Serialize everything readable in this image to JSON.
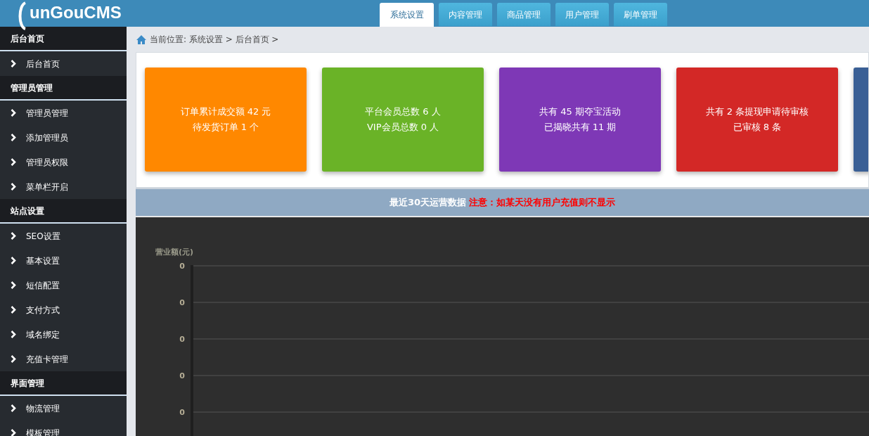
{
  "header": {
    "logo": "unGouCMS",
    "tabs": [
      {
        "label": "系统设置",
        "selected": true
      },
      {
        "label": "内容管理",
        "selected": false
      },
      {
        "label": "商品管理",
        "selected": false
      },
      {
        "label": "用户管理",
        "selected": false
      },
      {
        "label": "刷单管理",
        "selected": false
      }
    ]
  },
  "sidebar": {
    "sections": [
      {
        "title": "后台首页",
        "items": [
          "后台首页"
        ]
      },
      {
        "title": "管理员管理",
        "items": [
          "管理员管理",
          "添加管理员",
          "管理员权限",
          "菜单栏开启"
        ]
      },
      {
        "title": "站点设置",
        "items": [
          "SEO设置",
          "基本设置",
          "短信配置",
          "支付方式",
          "域名绑定",
          "充值卡管理"
        ]
      },
      {
        "title": "界面管理",
        "items": [
          "物流管理",
          "模板管理"
        ]
      }
    ]
  },
  "breadcrumb": "当前位置: 系统设置 > 后台首页 >",
  "stat_cards": [
    {
      "color": "#ff8800",
      "lines": [
        "订单累计成交额 42 元",
        "待发货订单 1 个"
      ]
    },
    {
      "color": "#6ab327",
      "lines": [
        "平台会员总数 6 人",
        "VIP会员总数 0 人"
      ]
    },
    {
      "color": "#7e38b6",
      "lines": [
        "共有 45 期夺宝活动",
        "已揭晓共有 11 期"
      ]
    },
    {
      "color": "#d32826",
      "lines": [
        "共有 2 条提现申请待审核",
        "已审核 8 条"
      ]
    },
    {
      "color": "#3a5f95"
    }
  ],
  "banner": {
    "title": "最近30天运营数据",
    "notice": "注意：如某天没有用户充值则不显示"
  },
  "chart": {
    "ylabel": "营业额(元)",
    "ytick_labels": [
      "0",
      "0",
      "0",
      "0",
      "0"
    ]
  }
}
